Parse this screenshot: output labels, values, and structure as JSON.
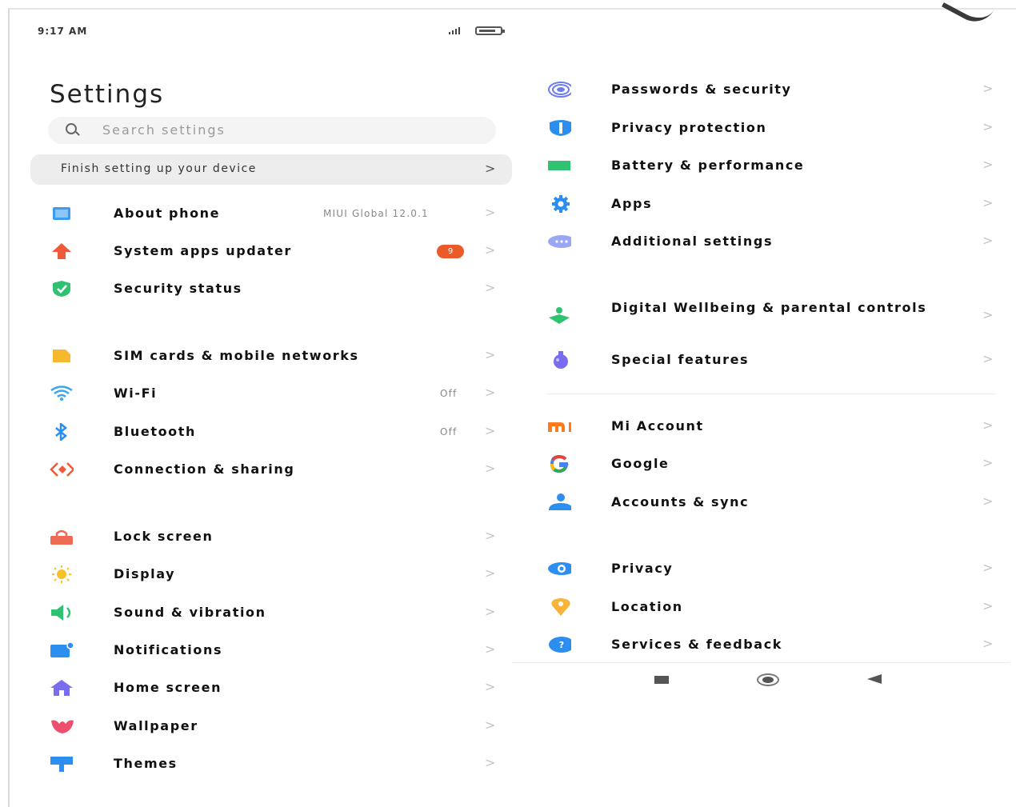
{
  "status": {
    "time": "9:17 AM"
  },
  "header": {
    "title": "Settings",
    "search_placeholder": "Search settings",
    "finish_setup": "Finish setting up your device"
  },
  "left_items": [
    {
      "label": "About phone",
      "value": "MIUI Global 12.0.1",
      "icon": "phone-info-icon",
      "color": "#3a9bf0"
    },
    {
      "label": "System apps updater",
      "badge": "9",
      "icon": "update-arrow-icon",
      "color": "#ef5a3a"
    },
    {
      "label": "Security status",
      "icon": "shield-check-icon",
      "color": "#2fc272"
    },
    {
      "label": "SIM cards & mobile networks",
      "icon": "sim-card-icon",
      "color": "#f5b82e"
    },
    {
      "label": "Wi-Fi",
      "value": "Off",
      "icon": "wifi-icon",
      "color": "#3aa6ee"
    },
    {
      "label": "Bluetooth",
      "value": "Off",
      "icon": "bluetooth-icon",
      "color": "#2c8ff0"
    },
    {
      "label": "Connection & sharing",
      "icon": "connection-sharing-icon",
      "color": "#ef5a3a"
    },
    {
      "label": "Lock screen",
      "icon": "lock-icon",
      "color": "#ef6a55"
    },
    {
      "label": "Display",
      "icon": "sun-icon",
      "color": "#f7c12c"
    },
    {
      "label": "Sound & vibration",
      "icon": "speaker-icon",
      "color": "#2fc272"
    },
    {
      "label": "Notifications",
      "icon": "notification-icon",
      "color": "#2c8ff0"
    },
    {
      "label": "Home screen",
      "icon": "home-icon",
      "color": "#7a6cf0"
    },
    {
      "label": "Wallpaper",
      "icon": "wallpaper-flower-icon",
      "color": "#ef4f6e"
    },
    {
      "label": "Themes",
      "icon": "themes-brush-icon",
      "color": "#2c8ff0"
    }
  ],
  "right_items": [
    {
      "label": "Passwords & security",
      "icon": "fingerprint-icon",
      "color": "#6b7bf0"
    },
    {
      "label": "Privacy protection",
      "icon": "privacy-shield-icon",
      "color": "#2c8ff0"
    },
    {
      "label": "Battery & performance",
      "icon": "battery-icon",
      "color": "#2fc272"
    },
    {
      "label": "Apps",
      "icon": "gear-icon",
      "color": "#2c8ff0"
    },
    {
      "label": "Additional settings",
      "icon": "more-dots-icon",
      "color": "#9aa7f5"
    },
    {
      "label": "Digital Wellbeing & parental controls",
      "icon": "wellbeing-icon",
      "color": "#2fc272"
    },
    {
      "label": "Special features",
      "icon": "special-features-icon",
      "color": "#7a6cf0"
    },
    {
      "label": "Mi Account",
      "icon": "mi-logo-icon",
      "color": "#ff7a1a"
    },
    {
      "label": "Google",
      "icon": "google-g-icon",
      "color": "#4285f4"
    },
    {
      "label": "Accounts & sync",
      "icon": "person-icon",
      "color": "#2c8ff0"
    },
    {
      "label": "Privacy",
      "icon": "eye-icon",
      "color": "#2c8ff0"
    },
    {
      "label": "Location",
      "icon": "location-pin-icon",
      "color": "#f7b33a"
    },
    {
      "label": "Services & feedback",
      "icon": "help-question-icon",
      "color": "#2c8ff0"
    }
  ],
  "chevron": ">"
}
